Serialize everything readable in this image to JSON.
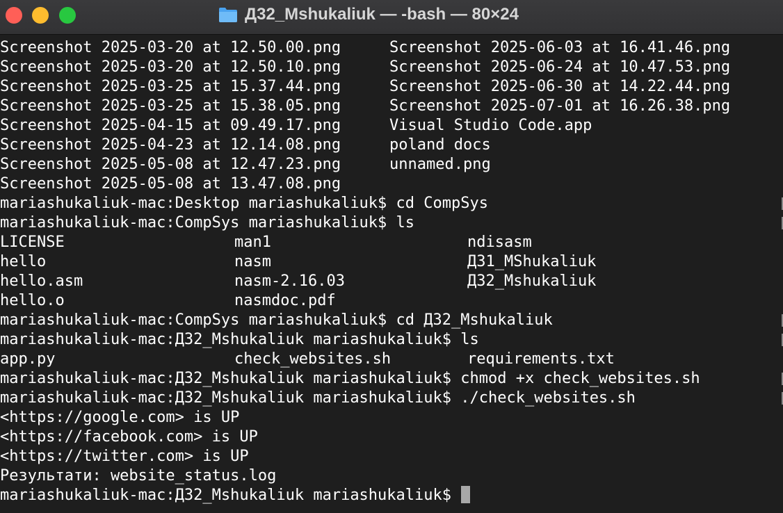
{
  "window": {
    "title": "Д32_Mshukaliuk — -bash — 80×24",
    "folder_icon": "folder-icon",
    "colors": {
      "background": "#1e1e1e",
      "text": "#ffffff",
      "close": "#ff5f57",
      "minimize": "#febc2e",
      "zoom": "#28c840"
    }
  },
  "terminal": {
    "ls_desktop": [
      [
        "Screenshot 2025-03-20 at 12.50.00.png",
        "Screenshot 2025-06-03 at 16.41.46.png"
      ],
      [
        "Screenshot 2025-03-20 at 12.50.10.png",
        "Screenshot 2025-06-24 at 10.47.53.png"
      ],
      [
        "Screenshot 2025-03-25 at 15.37.44.png",
        "Screenshot 2025-06-30 at 14.22.44.png"
      ],
      [
        "Screenshot 2025-03-25 at 15.38.05.png",
        "Screenshot 2025-07-01 at 16.26.38.png"
      ],
      [
        "Screenshot 2025-04-15 at 09.49.17.png",
        "Visual Studio Code.app"
      ],
      [
        "Screenshot 2025-04-23 at 12.14.08.png",
        "poland docs"
      ],
      [
        "Screenshot 2025-05-08 at 12.47.23.png",
        "unnamed.png"
      ],
      [
        "Screenshot 2025-05-08 at 13.47.08.png",
        ""
      ]
    ],
    "cmd_cd_compsys": "mariashukaliuk-mac:Desktop mariashukaliuk$ cd CompSys",
    "cmd_ls_compsys": "mariashukaliuk-mac:CompSys mariashukaliuk$ ls",
    "ls_compsys": [
      [
        "LICENSE",
        "man1",
        "ndisasm"
      ],
      [
        "hello",
        "nasm",
        "Д31_MShukaliuk"
      ],
      [
        "hello.asm",
        "nasm-2.16.03",
        "Д32_Mshukaliuk"
      ],
      [
        "hello.o",
        "nasmdoc.pdf",
        ""
      ]
    ],
    "cmd_cd_d32": "mariashukaliuk-mac:CompSys mariashukaliuk$ cd Д32_Mshukaliuk",
    "cmd_ls_d32": "mariashukaliuk-mac:Д32_Mshukaliuk mariashukaliuk$ ls",
    "ls_d32": [
      [
        "app.py",
        "check_websites.sh",
        "requirements.txt"
      ]
    ],
    "cmd_chmod": "mariashukaliuk-mac:Д32_Mshukaliuk mariashukaliuk$ chmod +x check_websites.sh",
    "cmd_run": "mariashukaliuk-mac:Д32_Mshukaliuk mariashukaliuk$ ./check_websites.sh",
    "output": [
      "<https://google.com> is UP",
      "<https://facebook.com> is UP",
      "<https://twitter.com> is UP",
      "Результати: website_status.log"
    ],
    "prompt": "mariashukaliuk-mac:Д32_Mshukaliuk mariashukaliuk$ "
  }
}
